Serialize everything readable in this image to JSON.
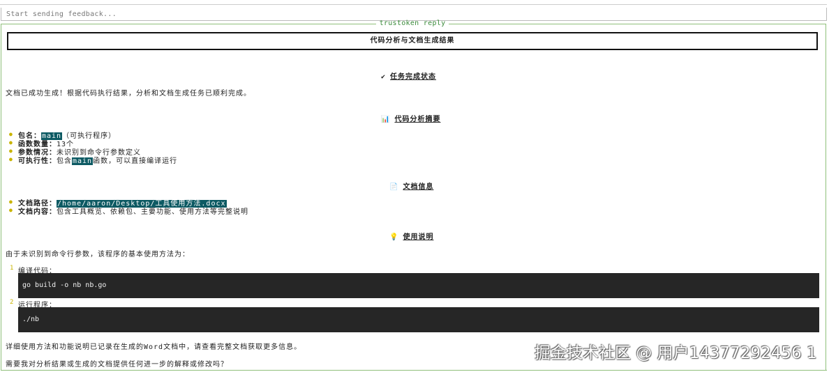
{
  "input": {
    "placeholder": "Start sending feedback..."
  },
  "panel": {
    "title": "trustoken reply"
  },
  "report": {
    "title": "代码分析与文档生成结果",
    "status": {
      "icon": "✔",
      "heading": "任务完成状态",
      "text": "文档已成功生成！根据代码执行结果，分析和文档生成任务已顺利完成。"
    },
    "summary": {
      "icon": "📊",
      "heading": "代码分析摘要",
      "items": [
        {
          "label": "包名：",
          "highlight": "main",
          "rest": "（可执行程序）"
        },
        {
          "label": "函数数量：",
          "rest": "13个"
        },
        {
          "label": "参数情况：",
          "rest": "未识别到命令行参数定义"
        },
        {
          "label": "可执行性：",
          "pre": "包含",
          "highlight": "main",
          "rest": "函数，可以直接编译运行"
        }
      ]
    },
    "doc": {
      "icon": "📄",
      "heading": "文档信息",
      "items": [
        {
          "label": "文档路径：",
          "highlight": "/home/aaron/Desktop/工具使用方法.docx"
        },
        {
          "label": "文档内容：",
          "rest": "包含工具概览、依赖包、主要功能、使用方法等完整说明"
        }
      ]
    },
    "usage": {
      "icon": "💡",
      "heading": "使用说明",
      "intro": "由于未识别到命令行参数，该程序的基本使用方法为：",
      "steps": [
        {
          "num": "1",
          "label": "编译代码：",
          "code": "go build -o nb nb.go"
        },
        {
          "num": "2",
          "label": "运行程序：",
          "code": "./nb"
        }
      ],
      "note": "详细使用方法和功能说明已记录在生成的Word文档中，请查看完整文档获取更多信息。",
      "question": "需要我对分析结果或生成的文档提供任何进一步的解释或修改吗？"
    }
  },
  "watermark": "掘金技术社区 @ 用户14377292456 1"
}
